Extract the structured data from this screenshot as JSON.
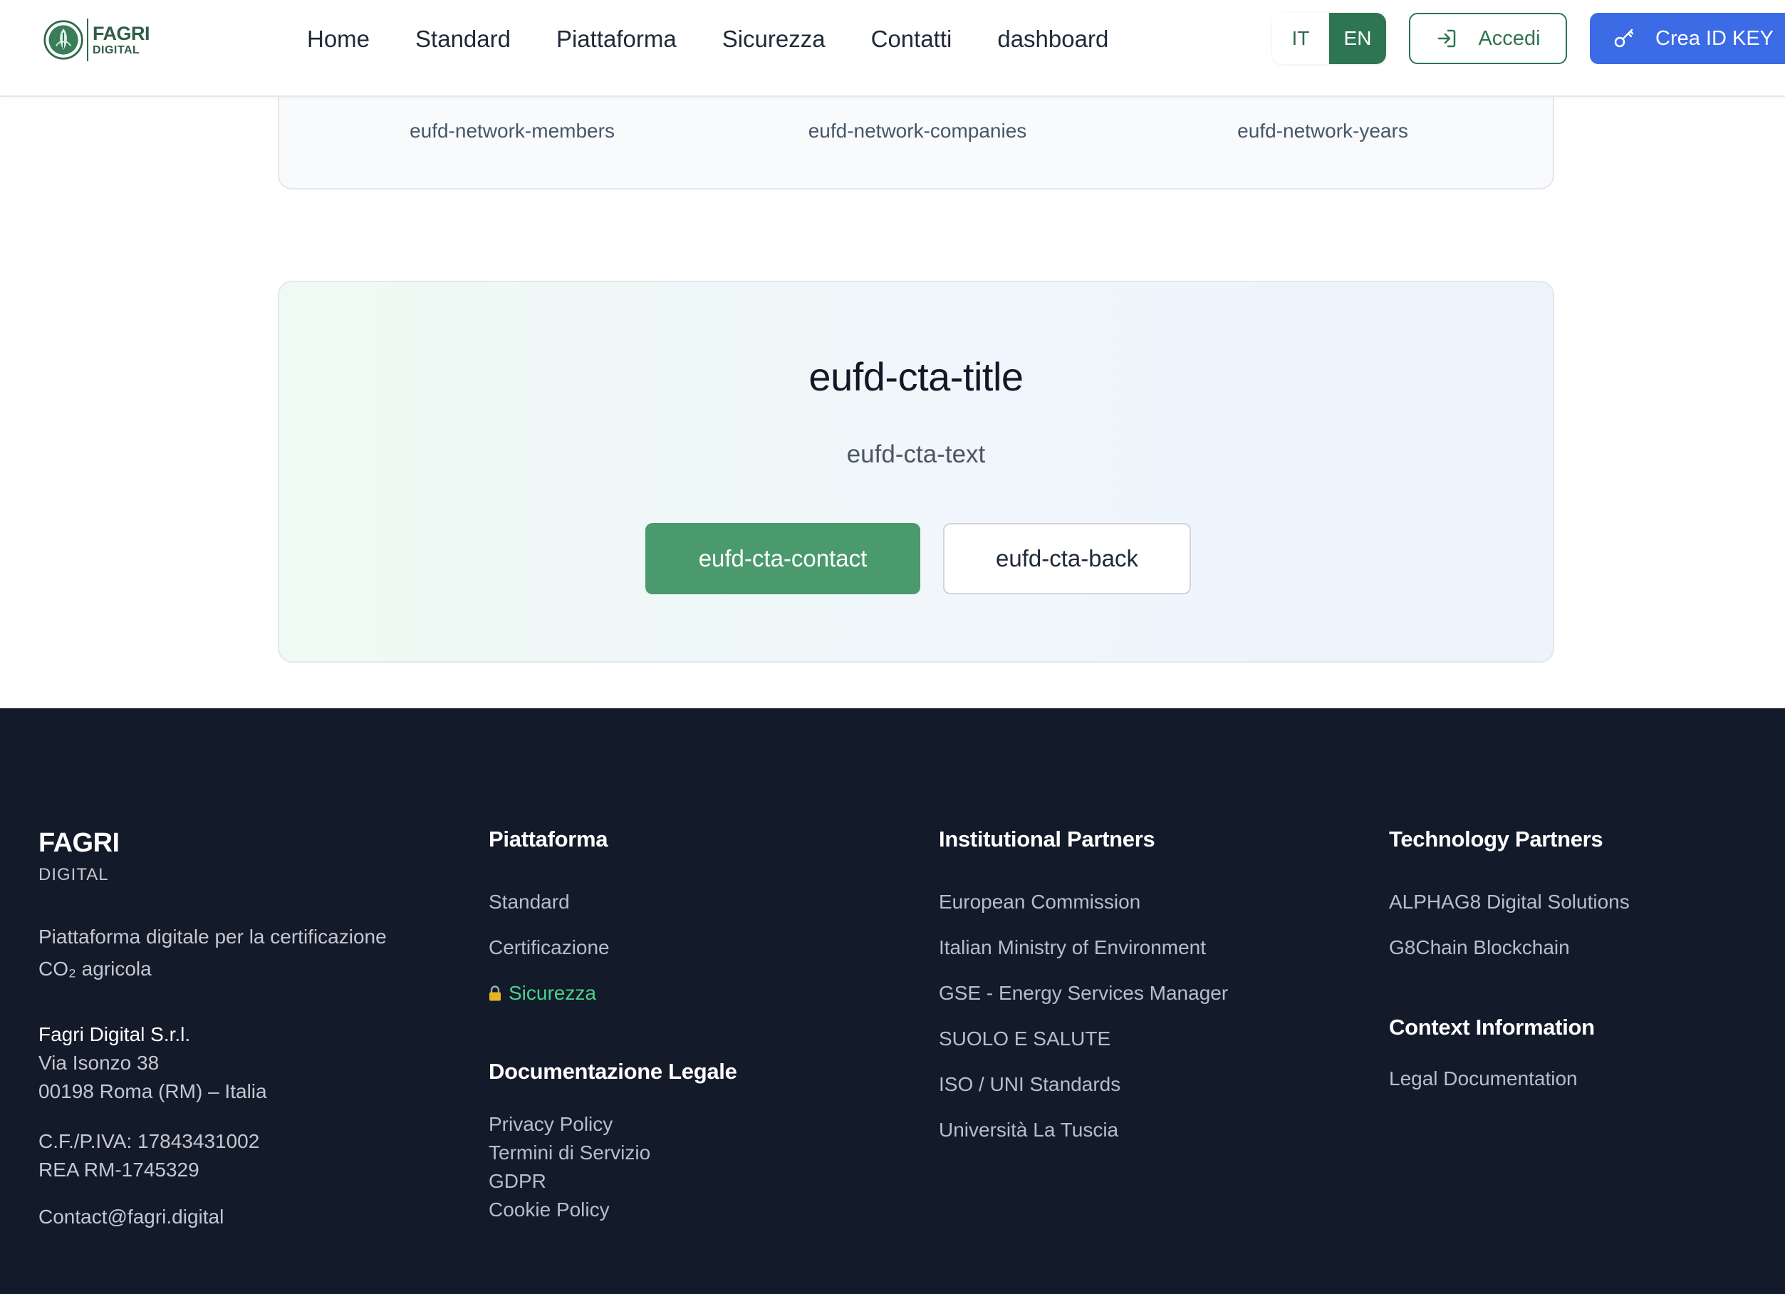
{
  "header": {
    "logo": {
      "line1": "FAGRI",
      "line2": "DIGITAL"
    },
    "nav": [
      "Home",
      "Standard",
      "Piattaforma",
      "Sicurezza",
      "Contatti",
      "dashboard"
    ],
    "lang": {
      "it": "IT",
      "en": "EN",
      "active": "EN"
    },
    "login_label": "Accedi",
    "create_label": "Crea ID KEY"
  },
  "stats": {
    "members": "eufd-network-members",
    "companies": "eufd-network-companies",
    "years": "eufd-network-years"
  },
  "cta": {
    "title": "eufd-cta-title",
    "text": "eufd-cta-text",
    "contact": "eufd-cta-contact",
    "back": "eufd-cta-back"
  },
  "footer": {
    "brand": {
      "name": "FAGRI",
      "sub": "DIGITAL",
      "desc1": "Piattaforma digitale per la certificazione",
      "desc2": "CO₂ agricola"
    },
    "company": {
      "name": "Fagri Digital S.r.l.",
      "street": "Via Isonzo 38",
      "city": "00198 Roma (RM) – Italia",
      "vat": "C.F./P.IVA: 17843431002",
      "rea": "REA RM-1745329",
      "email": "Contact@fagri.digital"
    },
    "platform": {
      "title": "Piattaforma",
      "links": [
        "Standard",
        "Certificazione",
        "Sicurezza"
      ]
    },
    "legal": {
      "title": "Documentazione Legale",
      "links": [
        "Privacy Policy",
        "Termini di Servizio",
        "GDPR",
        "Cookie Policy"
      ]
    },
    "institutional": {
      "title": "Institutional Partners",
      "links": [
        "European Commission",
        "Italian Ministry of Environment",
        "GSE - Energy Services Manager",
        "SUOLO E SALUTE",
        "ISO / UNI Standards",
        "Università La Tuscia"
      ]
    },
    "technology": {
      "title": "Technology Partners",
      "links": [
        "ALPHAG8 Digital Solutions",
        "G8Chain Blockchain"
      ]
    },
    "context": {
      "title": "Context Information",
      "links": [
        "Legal Documentation"
      ]
    }
  },
  "colors": {
    "brand_green": "#2e7552",
    "cta_green": "#4a9a6d",
    "primary_blue": "#3b6be5",
    "footer_bg": "#131a29",
    "security_green": "#4ccf8a"
  },
  "icons": [
    "logo-emblem-icon",
    "login-arrow-icon",
    "key-icon",
    "lock-icon"
  ]
}
